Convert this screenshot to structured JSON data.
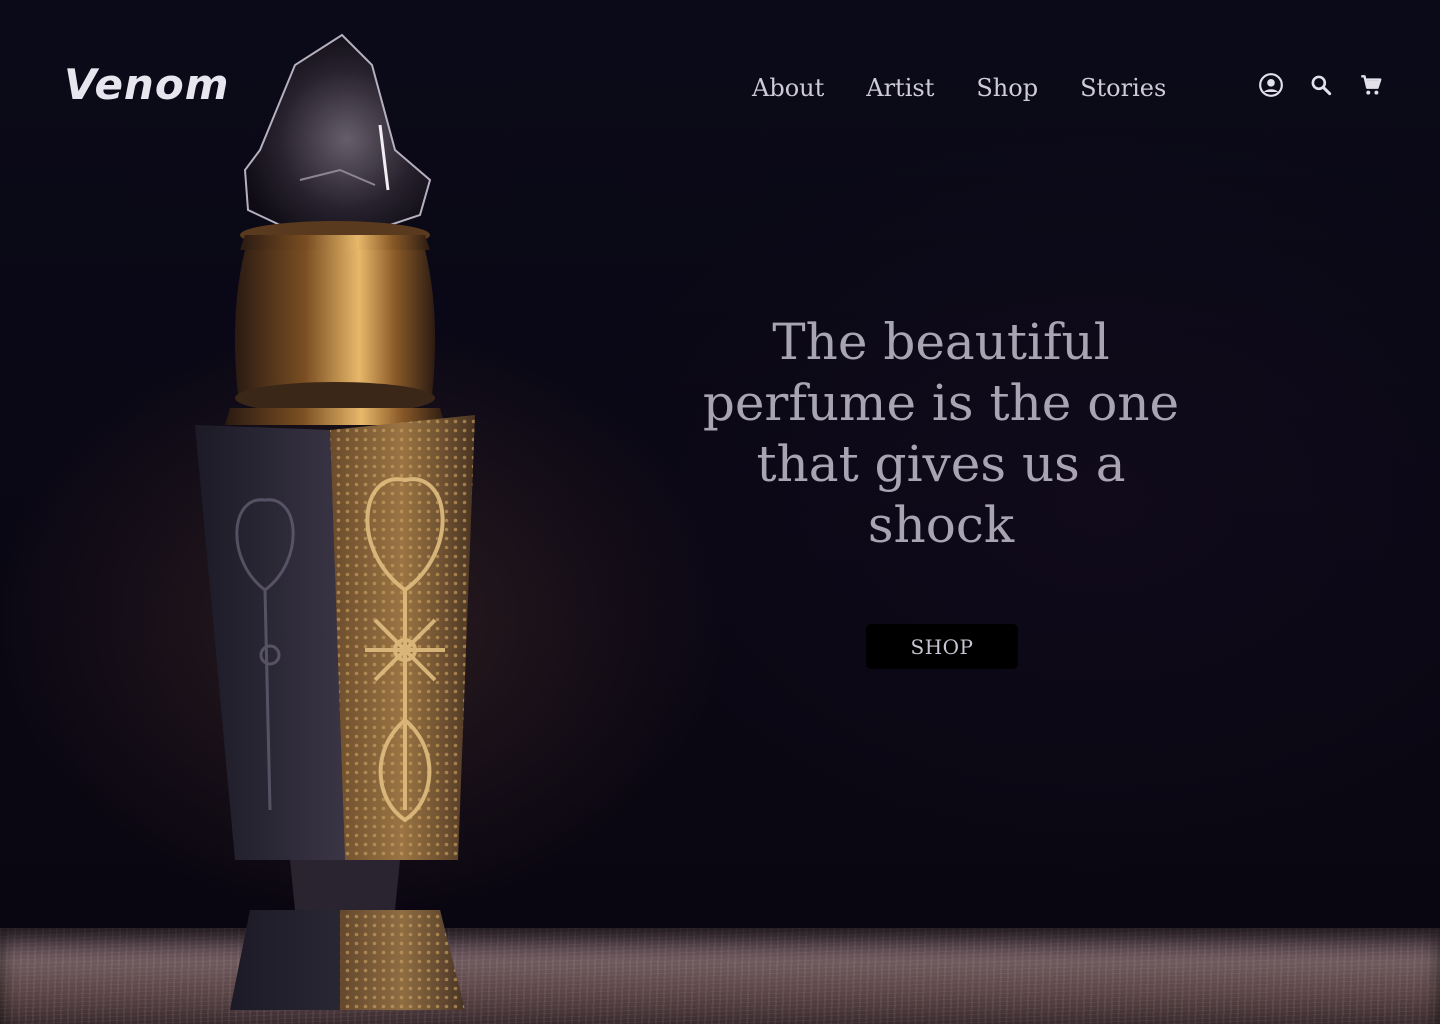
{
  "brand": {
    "logo_text": "Venom"
  },
  "nav": {
    "items": [
      {
        "label": "About"
      },
      {
        "label": "Artist"
      },
      {
        "label": "Shop"
      },
      {
        "label": "Stories"
      }
    ]
  },
  "header_icons": [
    {
      "icon": "account-circle-icon"
    },
    {
      "icon": "search-icon"
    },
    {
      "icon": "cart-icon"
    }
  ],
  "hero": {
    "headline": "The beautiful perfume is the one that gives us a shock",
    "cta_label": "SHOP"
  },
  "colors": {
    "background": "#090914",
    "text": "#cfcbd8",
    "headline": "#a8a4b2",
    "button": "#000000",
    "bottle_gold": "#b8843a"
  }
}
